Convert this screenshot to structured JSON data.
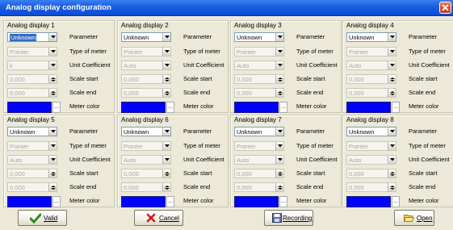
{
  "window": {
    "title": "Analog display configuration"
  },
  "row_labels": {
    "parameter": "Parameter",
    "meter_type": "Type of meter",
    "unit_coefficient": "Unit Coefficient",
    "scale_start": "Scale start",
    "scale_end": "Scale end",
    "meter_color": "Meter color"
  },
  "displays": [
    {
      "name": "Analog display 1",
      "parameter": "Unknown",
      "meter_type": "Pointer",
      "unit_coefficient": "k",
      "scale_start": "0,000",
      "scale_end": "0,000",
      "color": "#0000ff"
    },
    {
      "name": "Analog display 2",
      "parameter": "Unknown",
      "meter_type": "Pointer",
      "unit_coefficient": "Auto",
      "scale_start": "0,000",
      "scale_end": "0,000",
      "color": "#0000ff"
    },
    {
      "name": "Analog display 3",
      "parameter": "Unknown",
      "meter_type": "Pointer",
      "unit_coefficient": "Auto",
      "scale_start": "0,000",
      "scale_end": "0,000",
      "color": "#0000ff"
    },
    {
      "name": "Analog display 4",
      "parameter": "Unknown",
      "meter_type": "Pointer",
      "unit_coefficient": "Auto",
      "scale_start": "0,000",
      "scale_end": "0,000",
      "color": "#0000ff"
    },
    {
      "name": "Analog display 5",
      "parameter": "Unknown",
      "meter_type": "Pointer",
      "unit_coefficient": "Auto",
      "scale_start": "0,000",
      "scale_end": "0,000",
      "color": "#0000ff"
    },
    {
      "name": "Analog display 6",
      "parameter": "Unknown",
      "meter_type": "Pointer",
      "unit_coefficient": "Auto",
      "scale_start": "0,000",
      "scale_end": "0,000",
      "color": "#0000ff"
    },
    {
      "name": "Analog display 7",
      "parameter": "Unknown",
      "meter_type": "Pointer",
      "unit_coefficient": "Auto",
      "scale_start": "0,000",
      "scale_end": "0,000",
      "color": "#0000ff"
    },
    {
      "name": "Analog display 8",
      "parameter": "Unknown",
      "meter_type": "Pointer",
      "unit_coefficient": "Auto",
      "scale_start": "0,000",
      "scale_end": "0,000",
      "color": "#0000ff"
    }
  ],
  "color_button_label": "...",
  "buttons": {
    "valid": {
      "label": "Valid",
      "icon": "checkmark-icon"
    },
    "cancel": {
      "label": "Cancel",
      "icon": "red-x-icon"
    },
    "recording": {
      "label": "Recording",
      "icon": "floppy-disk-icon"
    },
    "open": {
      "label": "Open",
      "icon": "open-folder-icon"
    }
  },
  "colors": {
    "titlebar": "#0a4cd6",
    "meter_blue": "#0000ff",
    "dialog_bg": "#ece9d8"
  }
}
